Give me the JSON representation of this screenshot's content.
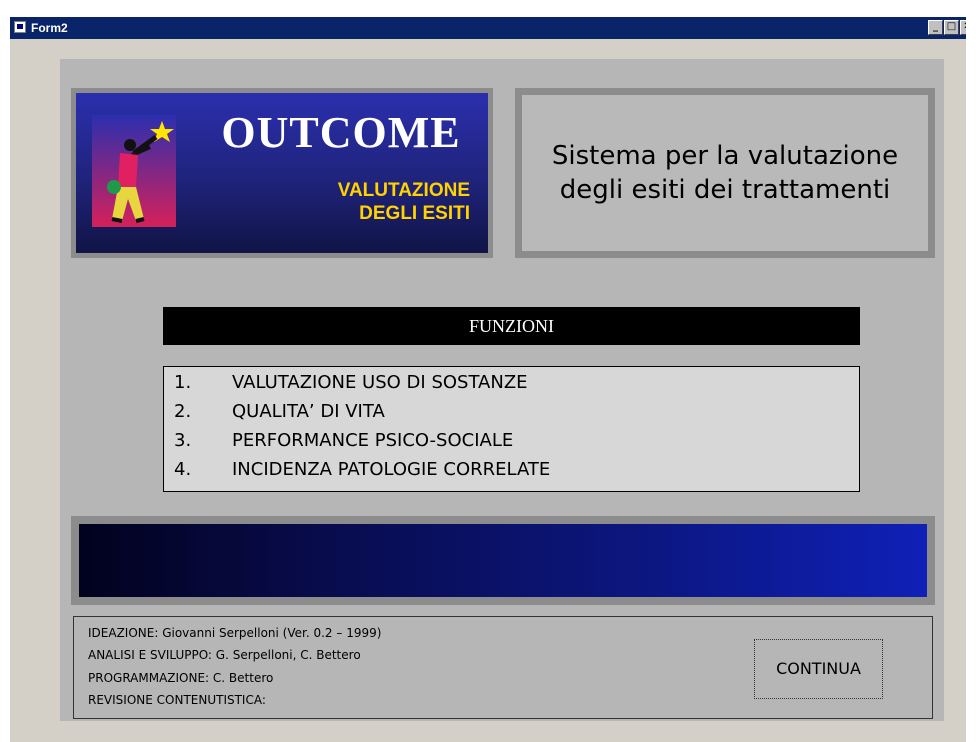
{
  "window": {
    "title": "Form2",
    "controls": {
      "minimize": "_",
      "maximize": "□",
      "close": "✕"
    }
  },
  "logo": {
    "title": "OUTCOME",
    "subtitle_line1": "VALUTAZIONE",
    "subtitle_line2": "DEGLI ESITI"
  },
  "description": {
    "line1": "Sistema per la valutazione",
    "line2": "degli esiti dei trattamenti"
  },
  "functions": {
    "header": "FUNZIONI",
    "items": [
      {
        "num": "1.",
        "label": "VALUTAZIONE USO DI SOSTANZE"
      },
      {
        "num": "2.",
        "label": "QUALITA’ DI VITA"
      },
      {
        "num": "3.",
        "label": "PERFORMANCE PSICO-SOCIALE"
      },
      {
        "num": "4.",
        "label": "INCIDENZA PATOLOGIE CORRELATE"
      }
    ]
  },
  "credits": {
    "ideazione": "IDEAZIONE: Giovanni Serpelloni (Ver. 0.2 – 1999)",
    "analisi": "ANALISI E SVILUPPO: G. Serpelloni, C. Bettero",
    "programmazione": "PROGRAMMAZIONE: C. Bettero",
    "revisione": "REVISIONE CONTENUTISTICA:"
  },
  "continue_button": "CONTINUA",
  "colors": {
    "titlebar": "#0a246a",
    "logo_subtitle": "#ffd200",
    "panel_bg": "#b6b6b6",
    "header_bg": "#000000"
  }
}
